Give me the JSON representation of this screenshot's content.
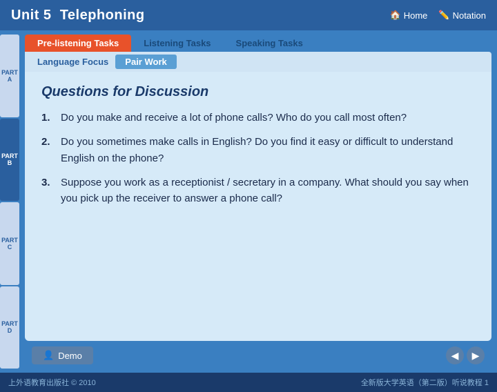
{
  "header": {
    "unit": "Unit 5",
    "title": "Telephoning",
    "nav": [
      {
        "label": "Home",
        "icon": "🏠"
      },
      {
        "label": "Notation",
        "icon": "✏️"
      }
    ]
  },
  "tabs": [
    {
      "label": "Pre-listening Tasks",
      "active": true
    },
    {
      "label": "Listening Tasks",
      "active": false
    },
    {
      "label": "Speaking Tasks",
      "active": false
    }
  ],
  "subtabs": {
    "language_focus": "Language Focus",
    "pair_work": "Pair Work"
  },
  "side_labels": [
    {
      "label": "PART A",
      "active": false
    },
    {
      "label": "PART B",
      "active": true
    },
    {
      "label": "PART C",
      "active": false
    },
    {
      "label": "PART D",
      "active": false
    }
  ],
  "content": {
    "title": "Questions for Discussion",
    "items": [
      {
        "num": "1.",
        "text": "Do you make and receive a lot of phone calls?  Who do you call most often?"
      },
      {
        "num": "2.",
        "text": "Do you sometimes make calls in English?  Do you find it easy or difficult to understand English on the phone?"
      },
      {
        "num": "3.",
        "text": "Suppose you work as a receptionist / secretary in a company.  What should you say when you pick up the receiver to answer a phone call?"
      }
    ]
  },
  "bottom": {
    "demo_label": "Demo",
    "demo_icon": "👤"
  },
  "footer": {
    "left": "上外语教育出版社 © 2010",
    "right": "全新版大学英语（第二版）听说教程 1"
  }
}
